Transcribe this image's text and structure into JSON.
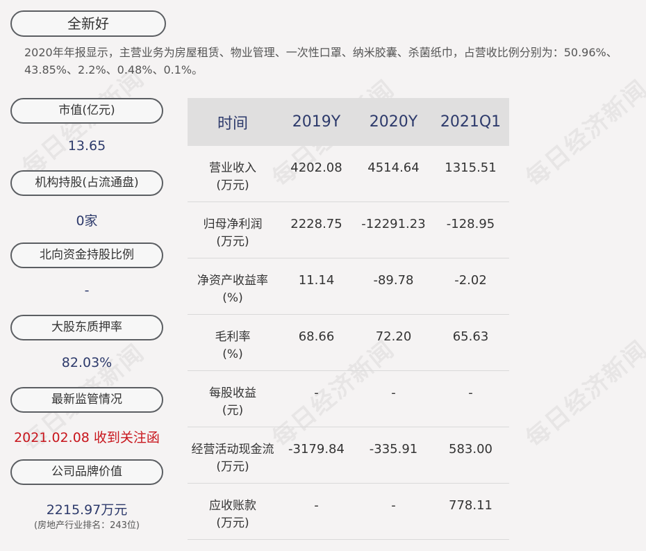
{
  "watermark_text": "每日经济新闻",
  "company": {
    "name": "全新好"
  },
  "summary": "2020年年报显示，主营业务为房屋租赁、物业管理、一次性口罩、纳米胶囊、杀菌纸巾，占营收比例分别为：50.96%、43.85%、2.2%、0.48%、0.1%。",
  "sidebar": {
    "market_cap": {
      "label": "市值(亿元)",
      "value": "13.65"
    },
    "institution": {
      "label": "机构持股(占流通盘)",
      "value": "0家"
    },
    "northbound": {
      "label": "北向资金持股比例",
      "value": "-"
    },
    "pledge": {
      "label": "大股东质押率",
      "value": "82.03%"
    },
    "regulation": {
      "label": "最新监管情况",
      "value": "2021.02.08 收到关注函"
    },
    "brand": {
      "label": "公司品牌价值",
      "value": "2215.97万元",
      "sub": "(房地产行业排名：243位)"
    }
  },
  "table": {
    "headers": [
      "时间",
      "2019Y",
      "2020Y",
      "2021Q1"
    ],
    "rows": [
      {
        "label1": "营业收入",
        "label2": "(万元)",
        "values": [
          "4202.08",
          "4514.64",
          "1315.51"
        ]
      },
      {
        "label1": "归母净利润",
        "label2": "(万元)",
        "values": [
          "2228.75",
          "-12291.23",
          "-128.95"
        ]
      },
      {
        "label1": "净资产收益率",
        "label2": "(%)",
        "values": [
          "11.14",
          "-89.78",
          "-2.02"
        ]
      },
      {
        "label1": "毛利率",
        "label2": "(%)",
        "values": [
          "68.66",
          "72.20",
          "65.63"
        ]
      },
      {
        "label1": "每股收益",
        "label2": "(元)",
        "values": [
          "-",
          "-",
          "-"
        ]
      },
      {
        "label1": "经营活动现金流",
        "label2": "(万元)",
        "values": [
          "-3179.84",
          "-335.91",
          "583.00"
        ]
      },
      {
        "label1": "应收账款",
        "label2": "(万元)",
        "values": [
          "-",
          "-",
          "778.11"
        ]
      }
    ]
  },
  "colors": {
    "accent": "#2d3a6b",
    "alert": "#c8161d",
    "header_bg": "#e0dfdf"
  }
}
